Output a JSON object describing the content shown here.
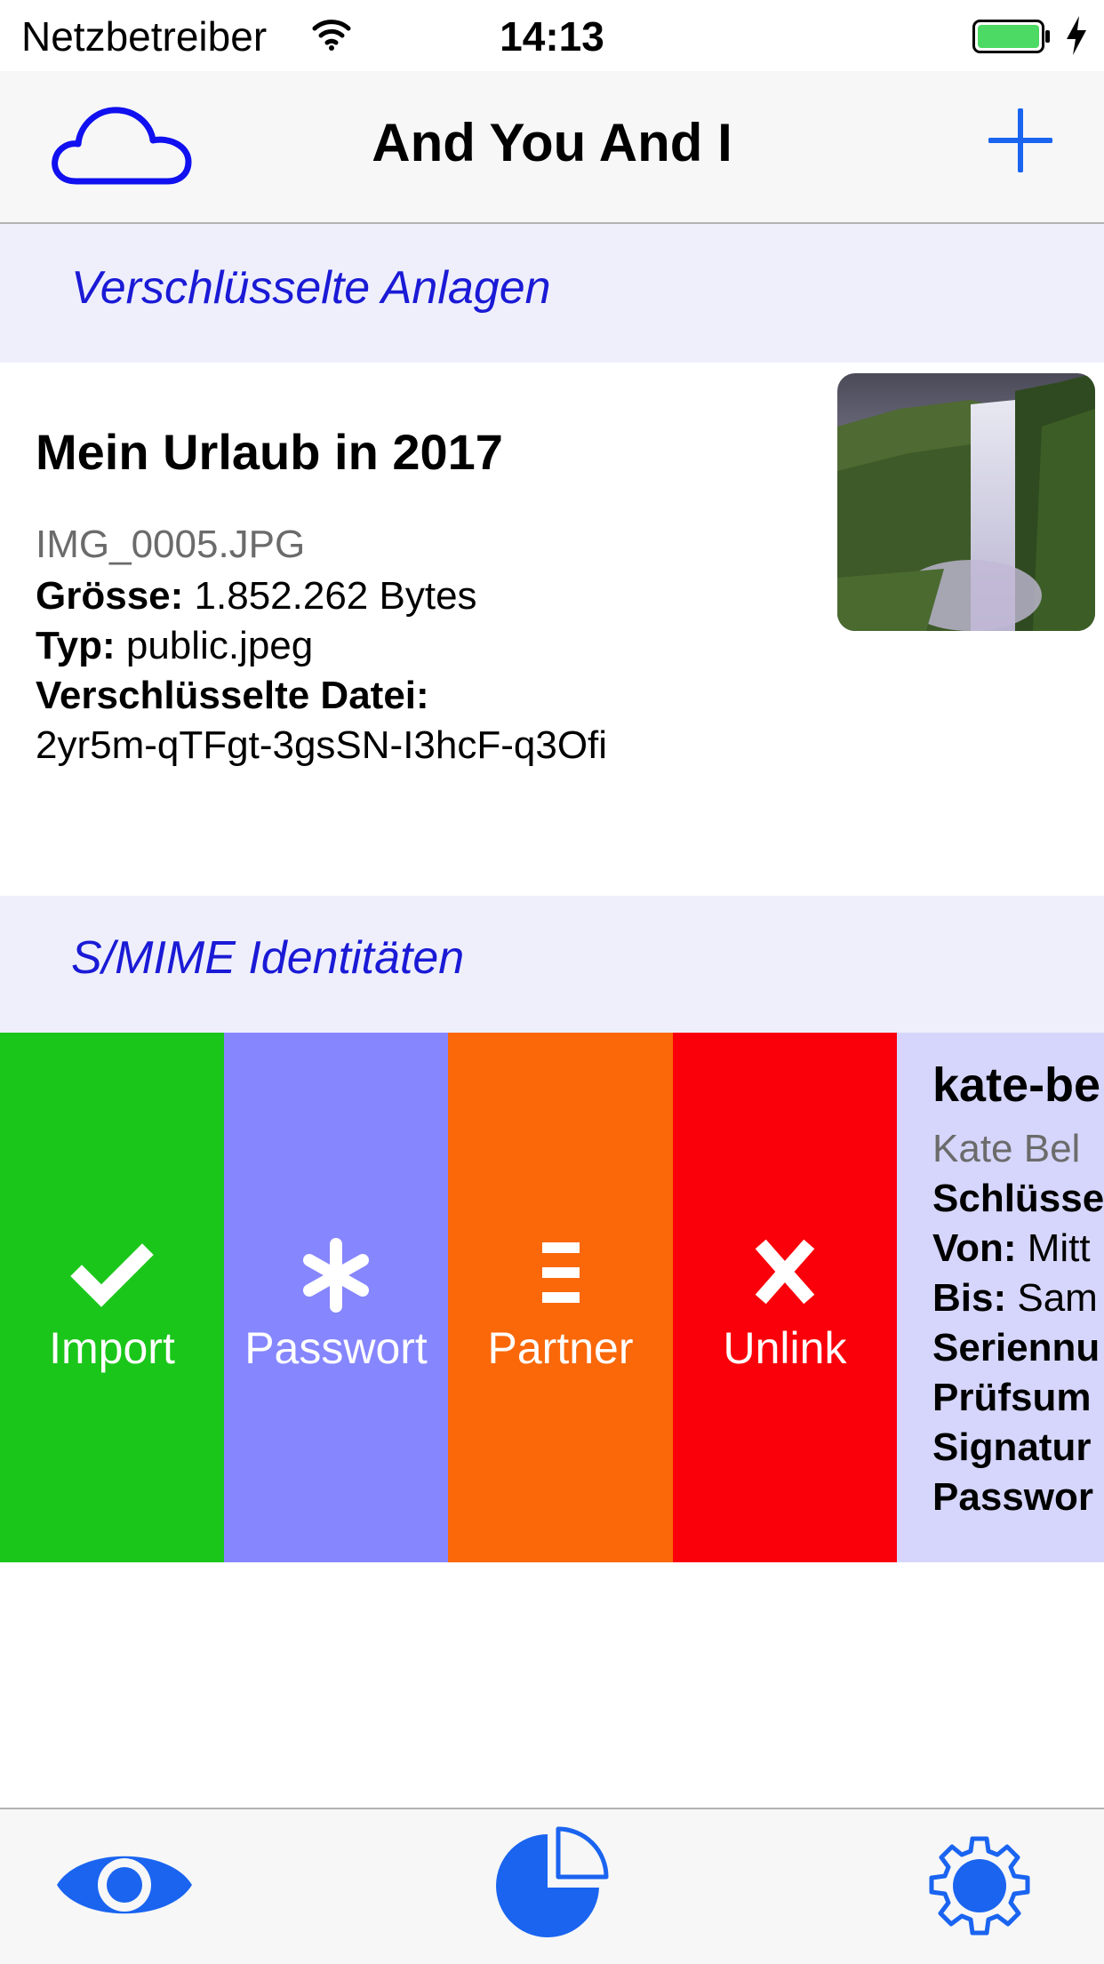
{
  "status_bar": {
    "carrier": "Netzbetreiber",
    "time": "14:13",
    "icons": [
      "wifi-icon",
      "battery-icon",
      "charging-bolt-icon"
    ]
  },
  "nav": {
    "title": "And You And I",
    "left_icon": "cloud-icon",
    "right_icon": "plus-icon",
    "accent_color": "#1a64f0"
  },
  "sections": {
    "attachments": "Verschlüsselte Anlagen",
    "identities": "S/MIME Identitäten"
  },
  "attachment": {
    "title": "Mein Urlaub in 2017",
    "filename": "IMG_0005.JPG",
    "size_label": "Grösse:",
    "size_value": "1.852.262 Bytes",
    "type_label": "Typ:",
    "type_value": "public.jpeg",
    "encrypted_label": "Verschlüsselte Datei:",
    "encrypted_value": "2yr5m-qTFgt-3gsSN-I3hcF-q3Ofi",
    "thumbnail": "waterfall-photo"
  },
  "swipe_actions": [
    {
      "label": "Import",
      "icon": "checkmark-icon",
      "color": "#1ac61a"
    },
    {
      "label": "Passwort",
      "icon": "asterisk-icon",
      "color": "#8686ff"
    },
    {
      "label": "Partner",
      "icon": "list-icon",
      "color": "#fa680a"
    },
    {
      "label": "Unlink",
      "icon": "cross-icon",
      "color": "#fa000a"
    }
  ],
  "identity": {
    "title": "kate-be",
    "name": "Kate Bel",
    "rows": [
      {
        "label": "Schlüsse",
        "value": ""
      },
      {
        "label": "Von:",
        "value": "Mitt"
      },
      {
        "label": "Bis:",
        "value": "Sam"
      },
      {
        "label": "Seriennu",
        "value": ""
      },
      {
        "label": "Prüfsum",
        "value": ""
      },
      {
        "label": "Signatur",
        "value": ""
      },
      {
        "label": "Passwor",
        "value": ""
      }
    ]
  },
  "tab_bar": {
    "tabs": [
      "eye-icon",
      "pie-chart-icon",
      "gear-icon"
    ],
    "color": "#1a64f0"
  }
}
